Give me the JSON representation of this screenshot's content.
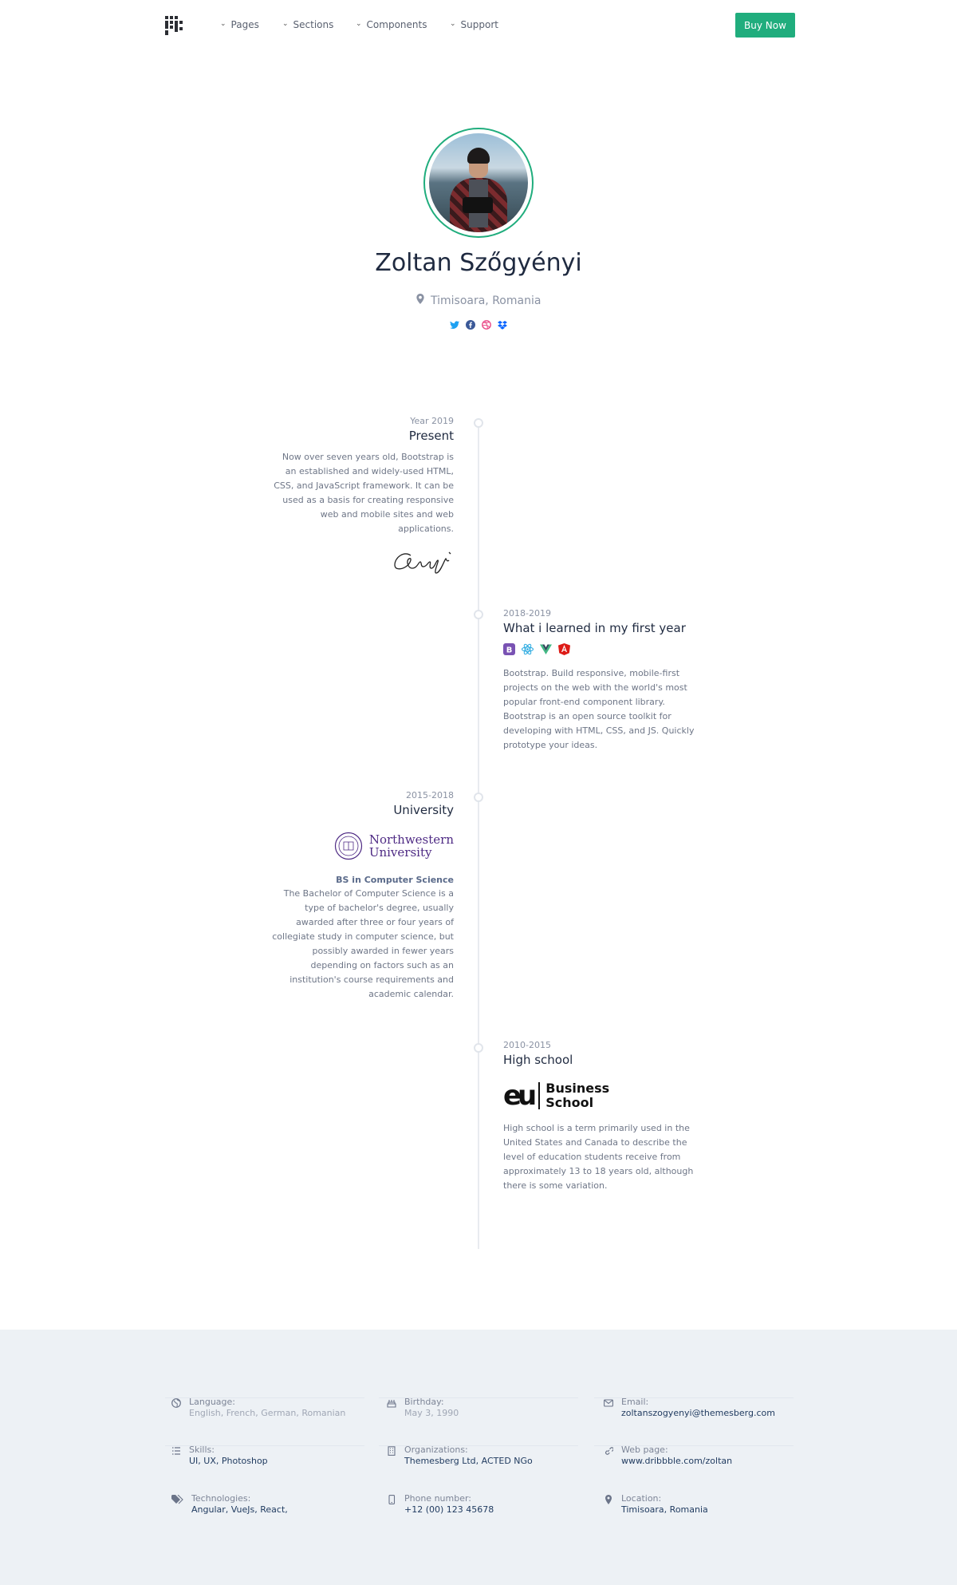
{
  "nav": {
    "items": [
      {
        "label": "Pages"
      },
      {
        "label": "Sections"
      },
      {
        "label": "Components"
      },
      {
        "label": "Support"
      }
    ],
    "buy_label": "Buy Now",
    "accent": "#20ad7d"
  },
  "profile": {
    "name": "Zoltan Szőgyényi",
    "location": "Timisoara, Romania",
    "socials": [
      "twitter-icon",
      "facebook-icon",
      "dribbble-icon",
      "dropbox-icon"
    ]
  },
  "timeline": [
    {
      "date": "Year 2019",
      "title": "Present",
      "text": "Now over seven years old, Bootstrap is an established and widely-used HTML, CSS, and JavaScript framework. It can be used as a basis for creating responsive web and mobile sites and web applications."
    },
    {
      "date": "2018-2019",
      "title": "What i learned in my first year",
      "tech": [
        "bootstrap-icon",
        "react-icon",
        "vue-icon",
        "angular-icon"
      ],
      "text": "Bootstrap. Build responsive, mobile-first projects on the web with the world's most popular front-end component library. Bootstrap is an open source toolkit for developing with HTML, CSS, and JS. Quickly prototype your ideas."
    },
    {
      "date": "2015-2018",
      "title": "University",
      "logo_text": [
        "Northwestern",
        "University"
      ],
      "subtitle": "BS in Computer Science",
      "text": "The Bachelor of Computer Science is a type of bachelor's degree, usually awarded after three or four years of collegiate study in computer science, but possibly awarded in fewer years depending on factors such as an institution's course requirements and academic calendar."
    },
    {
      "date": "2010-2015",
      "title": "High school",
      "logo_text": [
        "Business",
        "School"
      ],
      "logo_mark": "eu",
      "text": "High school is a term primarily used in the United States and Canada to describe the level of education students receive from approximately 13 to 18 years old, although there is some variation."
    }
  ],
  "info": [
    {
      "icon": "globe-icon",
      "label": "Language:",
      "value": "English, French, German, Romanian",
      "muted": true
    },
    {
      "icon": "cake-icon",
      "label": "Birthday:",
      "value": "May 3, 1990",
      "muted": true
    },
    {
      "icon": "envelope-icon",
      "label": "Email:",
      "value": "zoltanszogyenyi@themesberg.com"
    },
    {
      "icon": "list-icon",
      "label": "Skills:",
      "value": "UI, UX, Photoshop"
    },
    {
      "icon": "building-icon",
      "label": "Organizations:",
      "value": "Themesberg Ltd, ACTED NGo"
    },
    {
      "icon": "link-icon",
      "label": "Web page:",
      "value": "www.dribbble.com/zoltan"
    },
    {
      "icon": "tags-icon",
      "label": "Technologies:",
      "value": "Angular, VueJs, React,"
    },
    {
      "icon": "phone-icon",
      "label": "Phone number:",
      "value": "+12 (00) 123 45678"
    },
    {
      "icon": "location-icon",
      "label": "Location:",
      "value": "Timisoara, Romania"
    }
  ]
}
